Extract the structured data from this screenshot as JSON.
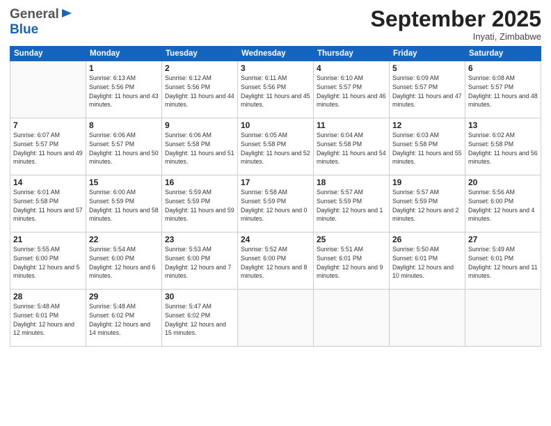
{
  "header": {
    "logo_general": "General",
    "logo_blue": "Blue",
    "month_title": "September 2025",
    "subtitle": "Inyati, Zimbabwe"
  },
  "days_of_week": [
    "Sunday",
    "Monday",
    "Tuesday",
    "Wednesday",
    "Thursday",
    "Friday",
    "Saturday"
  ],
  "weeks": [
    [
      {
        "day": "",
        "sunrise": "",
        "sunset": "",
        "daylight": ""
      },
      {
        "day": "1",
        "sunrise": "Sunrise: 6:13 AM",
        "sunset": "Sunset: 5:56 PM",
        "daylight": "Daylight: 11 hours and 43 minutes."
      },
      {
        "day": "2",
        "sunrise": "Sunrise: 6:12 AM",
        "sunset": "Sunset: 5:56 PM",
        "daylight": "Daylight: 11 hours and 44 minutes."
      },
      {
        "day": "3",
        "sunrise": "Sunrise: 6:11 AM",
        "sunset": "Sunset: 5:56 PM",
        "daylight": "Daylight: 11 hours and 45 minutes."
      },
      {
        "day": "4",
        "sunrise": "Sunrise: 6:10 AM",
        "sunset": "Sunset: 5:57 PM",
        "daylight": "Daylight: 11 hours and 46 minutes."
      },
      {
        "day": "5",
        "sunrise": "Sunrise: 6:09 AM",
        "sunset": "Sunset: 5:57 PM",
        "daylight": "Daylight: 11 hours and 47 minutes."
      },
      {
        "day": "6",
        "sunrise": "Sunrise: 6:08 AM",
        "sunset": "Sunset: 5:57 PM",
        "daylight": "Daylight: 11 hours and 48 minutes."
      }
    ],
    [
      {
        "day": "7",
        "sunrise": "Sunrise: 6:07 AM",
        "sunset": "Sunset: 5:57 PM",
        "daylight": "Daylight: 11 hours and 49 minutes."
      },
      {
        "day": "8",
        "sunrise": "Sunrise: 6:06 AM",
        "sunset": "Sunset: 5:57 PM",
        "daylight": "Daylight: 11 hours and 50 minutes."
      },
      {
        "day": "9",
        "sunrise": "Sunrise: 6:06 AM",
        "sunset": "Sunset: 5:58 PM",
        "daylight": "Daylight: 11 hours and 51 minutes."
      },
      {
        "day": "10",
        "sunrise": "Sunrise: 6:05 AM",
        "sunset": "Sunset: 5:58 PM",
        "daylight": "Daylight: 11 hours and 52 minutes."
      },
      {
        "day": "11",
        "sunrise": "Sunrise: 6:04 AM",
        "sunset": "Sunset: 5:58 PM",
        "daylight": "Daylight: 11 hours and 54 minutes."
      },
      {
        "day": "12",
        "sunrise": "Sunrise: 6:03 AM",
        "sunset": "Sunset: 5:58 PM",
        "daylight": "Daylight: 11 hours and 55 minutes."
      },
      {
        "day": "13",
        "sunrise": "Sunrise: 6:02 AM",
        "sunset": "Sunset: 5:58 PM",
        "daylight": "Daylight: 11 hours and 56 minutes."
      }
    ],
    [
      {
        "day": "14",
        "sunrise": "Sunrise: 6:01 AM",
        "sunset": "Sunset: 5:58 PM",
        "daylight": "Daylight: 11 hours and 57 minutes."
      },
      {
        "day": "15",
        "sunrise": "Sunrise: 6:00 AM",
        "sunset": "Sunset: 5:59 PM",
        "daylight": "Daylight: 11 hours and 58 minutes."
      },
      {
        "day": "16",
        "sunrise": "Sunrise: 5:59 AM",
        "sunset": "Sunset: 5:59 PM",
        "daylight": "Daylight: 11 hours and 59 minutes."
      },
      {
        "day": "17",
        "sunrise": "Sunrise: 5:58 AM",
        "sunset": "Sunset: 5:59 PM",
        "daylight": "Daylight: 12 hours and 0 minutes."
      },
      {
        "day": "18",
        "sunrise": "Sunrise: 5:57 AM",
        "sunset": "Sunset: 5:59 PM",
        "daylight": "Daylight: 12 hours and 1 minute."
      },
      {
        "day": "19",
        "sunrise": "Sunrise: 5:57 AM",
        "sunset": "Sunset: 5:59 PM",
        "daylight": "Daylight: 12 hours and 2 minutes."
      },
      {
        "day": "20",
        "sunrise": "Sunrise: 5:56 AM",
        "sunset": "Sunset: 6:00 PM",
        "daylight": "Daylight: 12 hours and 4 minutes."
      }
    ],
    [
      {
        "day": "21",
        "sunrise": "Sunrise: 5:55 AM",
        "sunset": "Sunset: 6:00 PM",
        "daylight": "Daylight: 12 hours and 5 minutes."
      },
      {
        "day": "22",
        "sunrise": "Sunrise: 5:54 AM",
        "sunset": "Sunset: 6:00 PM",
        "daylight": "Daylight: 12 hours and 6 minutes."
      },
      {
        "day": "23",
        "sunrise": "Sunrise: 5:53 AM",
        "sunset": "Sunset: 6:00 PM",
        "daylight": "Daylight: 12 hours and 7 minutes."
      },
      {
        "day": "24",
        "sunrise": "Sunrise: 5:52 AM",
        "sunset": "Sunset: 6:00 PM",
        "daylight": "Daylight: 12 hours and 8 minutes."
      },
      {
        "day": "25",
        "sunrise": "Sunrise: 5:51 AM",
        "sunset": "Sunset: 6:01 PM",
        "daylight": "Daylight: 12 hours and 9 minutes."
      },
      {
        "day": "26",
        "sunrise": "Sunrise: 5:50 AM",
        "sunset": "Sunset: 6:01 PM",
        "daylight": "Daylight: 12 hours and 10 minutes."
      },
      {
        "day": "27",
        "sunrise": "Sunrise: 5:49 AM",
        "sunset": "Sunset: 6:01 PM",
        "daylight": "Daylight: 12 hours and 11 minutes."
      }
    ],
    [
      {
        "day": "28",
        "sunrise": "Sunrise: 5:48 AM",
        "sunset": "Sunset: 6:01 PM",
        "daylight": "Daylight: 12 hours and 12 minutes."
      },
      {
        "day": "29",
        "sunrise": "Sunrise: 5:48 AM",
        "sunset": "Sunset: 6:02 PM",
        "daylight": "Daylight: 12 hours and 14 minutes."
      },
      {
        "day": "30",
        "sunrise": "Sunrise: 5:47 AM",
        "sunset": "Sunset: 6:02 PM",
        "daylight": "Daylight: 12 hours and 15 minutes."
      },
      {
        "day": "",
        "sunrise": "",
        "sunset": "",
        "daylight": ""
      },
      {
        "day": "",
        "sunrise": "",
        "sunset": "",
        "daylight": ""
      },
      {
        "day": "",
        "sunrise": "",
        "sunset": "",
        "daylight": ""
      },
      {
        "day": "",
        "sunrise": "",
        "sunset": "",
        "daylight": ""
      }
    ]
  ]
}
